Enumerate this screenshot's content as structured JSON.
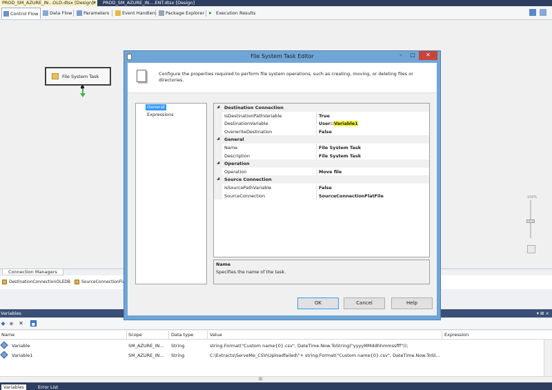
{
  "doc_tabs": [
    {
      "label": "PROD_SM_AZURE_IN...OLD.dtsx [Design]*",
      "active": true
    },
    {
      "label": "PROD_SM_AZURE_IN....ENT.dtsx [Design]",
      "active": false
    }
  ],
  "doc_tab_close": "×",
  "designer_tabs": [
    {
      "label": "Control Flow",
      "active": true
    },
    {
      "label": "Data Flow"
    },
    {
      "label": "Parameters"
    },
    {
      "label": "Event Handlers"
    },
    {
      "label": "Package Explorer"
    },
    {
      "label": "Execution Results"
    }
  ],
  "canvas": {
    "task_label": "File System Task",
    "zoom_label": "100%"
  },
  "connection_managers": {
    "tab_label": "Connection Managers",
    "items": [
      "DestinationConnectionOLEDB",
      "SourceConnectionFlatFi"
    ]
  },
  "variables": {
    "title": "Variables",
    "title_controls": "▾ &#x1F4CC; ×",
    "columns": [
      "Name",
      "Scope",
      "Data type",
      "Value",
      "Expression"
    ],
    "rows": [
      {
        "name": "Variable",
        "scope": "SM_AZURE_IN...",
        "type": "String",
        "value": "string.Format(\"Custom name{0}.csv\", DateTime.Now.ToString(\"yyyyMMddhhmmssfff\"));",
        "expression": ""
      },
      {
        "name": "Variable1",
        "scope": "SM_AZURE_IN...",
        "type": "String",
        "value": "C:\\Extracts\\ServeMe_CSV\\Uploadfailed\\\"+ string.Format(\"Custom name{0}.csv\", DateTime.Now.ToSt...",
        "expression": ""
      }
    ],
    "hscroll_mark": "III"
  },
  "bottom_tabs": [
    {
      "label": "Variables",
      "active": true
    },
    {
      "label": "Error List",
      "active": false
    }
  ],
  "dialog": {
    "title": "File System Task Editor",
    "minimize": "–",
    "maximize": "□",
    "close": "✕",
    "description": "Configure the properties required to perform file system operations, such as creating, moving, or deleting files or directories.",
    "nav_items": [
      {
        "label": "General",
        "selected": true
      },
      {
        "label": "Expressions",
        "selected": false
      }
    ],
    "properties": [
      {
        "kind": "category",
        "name": "Destination Connection"
      },
      {
        "kind": "prop",
        "name": "IsDestinationPathVariable",
        "value": "True"
      },
      {
        "kind": "prop",
        "name": "DestinationVariable",
        "value_prefix": "User::",
        "value_highlight": "Variable1"
      },
      {
        "kind": "prop",
        "name": "OverwriteDestination",
        "value": "False"
      },
      {
        "kind": "category",
        "name": "General"
      },
      {
        "kind": "prop",
        "name": "Name",
        "value": "File System Task"
      },
      {
        "kind": "prop",
        "name": "Description",
        "value": "File System Task"
      },
      {
        "kind": "category",
        "name": "Operation"
      },
      {
        "kind": "prop",
        "name": "Operation",
        "value": "Move file"
      },
      {
        "kind": "category",
        "name": "Source Connection"
      },
      {
        "kind": "prop",
        "name": "IsSourcePathVariable",
        "value": "False"
      },
      {
        "kind": "prop",
        "name": "SourceConnection",
        "value": "SourceConnectionFlatFile"
      }
    ],
    "desc_title": "Name",
    "desc_text": "Specifies the name of the task.",
    "buttons": {
      "ok": "OK",
      "cancel": "Cancel",
      "help": "Help"
    }
  },
  "colors": {
    "dialog_frame": "#6fa6d7",
    "selection": "#3399ff",
    "highlight": "#f7f43a",
    "close_button": "#c7443b",
    "panel_title": "#3a4f76"
  }
}
